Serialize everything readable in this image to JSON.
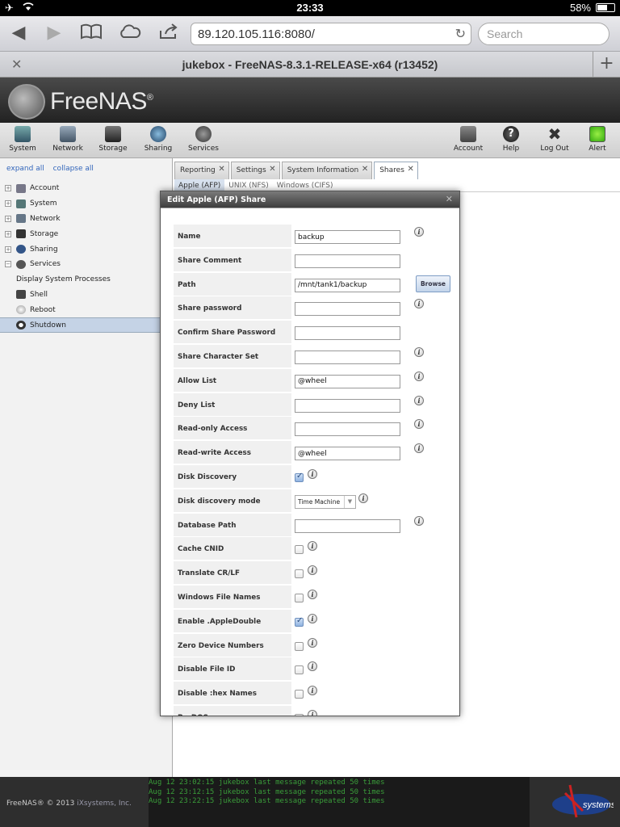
{
  "status_bar": {
    "time": "23:33",
    "battery": "58%"
  },
  "browser": {
    "url": "89.120.105.116:8080/",
    "search_placeholder": "Search",
    "tab_title": "jukebox - FreeNAS-8.3.1-RELEASE-x64 (r13452)"
  },
  "header": {
    "logo_text": "FreeNAS",
    "logo_reg": "®"
  },
  "main_nav": {
    "left": [
      {
        "label": "System",
        "icon": "system-icon"
      },
      {
        "label": "Network",
        "icon": "network-icon"
      },
      {
        "label": "Storage",
        "icon": "storage-icon"
      },
      {
        "label": "Sharing",
        "icon": "sharing-icon"
      },
      {
        "label": "Services",
        "icon": "services-icon"
      }
    ],
    "right": [
      {
        "label": "Account",
        "icon": "account-icon"
      },
      {
        "label": "Help",
        "icon": "help-icon"
      },
      {
        "label": "Log Out",
        "icon": "logout-icon"
      },
      {
        "label": "Alert",
        "icon": "alert-icon"
      }
    ]
  },
  "tree": {
    "expand_all": "expand all",
    "collapse_all": "collapse all",
    "items": [
      {
        "label": "Account",
        "type": "parent"
      },
      {
        "label": "System",
        "type": "parent"
      },
      {
        "label": "Network",
        "type": "parent"
      },
      {
        "label": "Storage",
        "type": "parent"
      },
      {
        "label": "Sharing",
        "type": "parent"
      },
      {
        "label": "Services",
        "type": "parent-open"
      },
      {
        "label": "Display System Processes",
        "type": "child"
      },
      {
        "label": "Shell",
        "type": "child"
      },
      {
        "label": "Reboot",
        "type": "child"
      },
      {
        "label": "Shutdown",
        "type": "child",
        "selected": true
      }
    ]
  },
  "content_tabs": [
    {
      "label": "Reporting"
    },
    {
      "label": "Settings"
    },
    {
      "label": "System Information"
    },
    {
      "label": "Shares",
      "active": true
    }
  ],
  "sub_tabs": [
    {
      "label": "Apple (AFP)",
      "active": true
    },
    {
      "label": "UNIX (NFS)"
    },
    {
      "label": "Windows (CIFS)"
    }
  ],
  "dialog": {
    "title": "Edit Apple (AFP) Share",
    "browse_label": "Browse",
    "fields": [
      {
        "label": "Name",
        "type": "text",
        "value": "backup",
        "info": true
      },
      {
        "label": "Share Comment",
        "type": "text",
        "value": "",
        "info": false
      },
      {
        "label": "Path",
        "type": "text",
        "value": "/mnt/tank1/backup",
        "info": false,
        "browse": true
      },
      {
        "label": "Share password",
        "type": "text",
        "value": "",
        "info": true
      },
      {
        "label": "Confirm Share Password",
        "type": "text",
        "value": "",
        "info": false
      },
      {
        "label": "Share Character Set",
        "type": "text",
        "value": "",
        "info": true
      },
      {
        "label": "Allow List",
        "type": "text",
        "value": "@wheel",
        "info": true
      },
      {
        "label": "Deny List",
        "type": "text",
        "value": "",
        "info": true
      },
      {
        "label": "Read-only Access",
        "type": "text",
        "value": "",
        "info": true
      },
      {
        "label": "Read-write Access",
        "type": "text",
        "value": "@wheel",
        "info": true
      },
      {
        "label": "Disk Discovery",
        "type": "checkbox",
        "checked": true,
        "info": true
      },
      {
        "label": "Disk discovery mode",
        "type": "select",
        "value": "Time Machine",
        "info": true
      },
      {
        "label": "Database Path",
        "type": "text",
        "value": "",
        "info": true
      },
      {
        "label": "Cache CNID",
        "type": "checkbox",
        "checked": false,
        "info": true
      },
      {
        "label": "Translate CR/LF",
        "type": "checkbox",
        "checked": false,
        "info": true
      },
      {
        "label": "Windows File Names",
        "type": "checkbox",
        "checked": false,
        "info": true
      },
      {
        "label": "Enable .AppleDouble",
        "type": "checkbox",
        "checked": true,
        "info": true
      },
      {
        "label": "Zero Device Numbers",
        "type": "checkbox",
        "checked": false,
        "info": true
      },
      {
        "label": "Disable File ID",
        "type": "checkbox",
        "checked": false,
        "info": true
      },
      {
        "label": "Disable :hex Names",
        "type": "checkbox",
        "checked": false,
        "info": true
      },
      {
        "label": "ProDOS",
        "type": "checkbox",
        "checked": false,
        "info": true
      }
    ]
  },
  "footer": {
    "copyright": "FreeNAS® © 2013",
    "company": "iXsystems, Inc.",
    "log": [
      "Aug 12 23:02:15 jukebox last message repeated 50 times",
      "Aug 12 23:12:15 jukebox last message repeated 50 times",
      "Aug 12 23:22:15 jukebox last message repeated 50 times"
    ],
    "ix_logo_text": "systems"
  },
  "colors": {
    "accent": "#3366bb",
    "log_green": "#3a9d3a",
    "selected_row": "#c5d3e6"
  }
}
